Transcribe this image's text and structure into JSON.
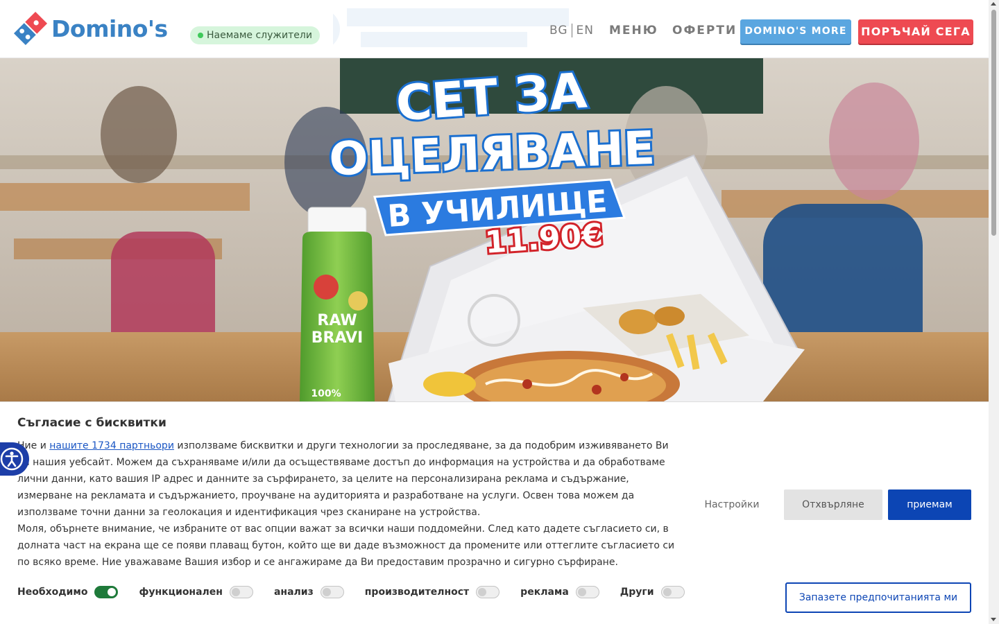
{
  "header": {
    "logo_text": "Domino's",
    "hiring_badge": "Наемаме служители",
    "lang_bg": "BG",
    "lang_en": "EN",
    "nav_menu": "МЕНЮ",
    "nav_offers": "ОФЕРТИ",
    "btn_more": "DOMINO'S MORE",
    "btn_order": "ПОРЪЧАЙ СЕГА",
    "brand_blue": "#3a82c4",
    "brand_red": "#ee4a52"
  },
  "hero": {
    "headline_line1": "СЕТ ЗА",
    "headline_line2": "ОЦЕЛЯВАНЕ",
    "headline_ribbon": "В УЧИЛИЩЕ",
    "price": "11.90€",
    "bottle_label_1": "RAW",
    "bottle_label_2": "BRAVI",
    "bottle_percent": "100%"
  },
  "cookie": {
    "title": "Съгласие с бисквитки",
    "text_before_link": "Ние и ",
    "partners_link": "нашите 1734 партньори",
    "text_after_link": " използваме бисквитки и други технологии за проследяване, за да подобрим изживяването Ви на нашия уебсайт. Можем да съхраняваме и/или да осъществяваме достъп до информация на устройства и да обработваме лични данни, като вашия IP адрес и данните за сърфирането, за целите на персонализирана реклама и съдържание, измерване на рекламата и съдържанието, проучване на аудиторията и разработване на услуги. Освен това можем да използваме точни данни за геолокация и идентификация чрез сканиране на устройства.",
    "text_second": "Моля, обърнете внимание, че избраните от вас опции важат за всички наши поддомейни. След като дадете съгласието си, в долната част на екрана ще се появи плаващ бутон, който ще ви даде възможност да промените или оттеглите съгласието си по всяко време. Ние уважаваме Вашия избор и се ангажираме да Ви предоставим прозрачно и сигурно сърфиране.",
    "toggles": [
      {
        "label": "Необходимо",
        "on": true
      },
      {
        "label": "функционален",
        "on": false
      },
      {
        "label": "анализ",
        "on": false
      },
      {
        "label": "производителност",
        "on": false
      },
      {
        "label": "реклама",
        "on": false
      },
      {
        "label": "Други",
        "on": false
      }
    ],
    "btn_settings": "Настройки",
    "btn_reject": "Отхвърляне",
    "btn_accept": "приемам",
    "btn_save": "Запазете предпочитанията ми",
    "accent": "#0c45b4"
  },
  "accessibility": {
    "icon": "accessibility-icon"
  }
}
